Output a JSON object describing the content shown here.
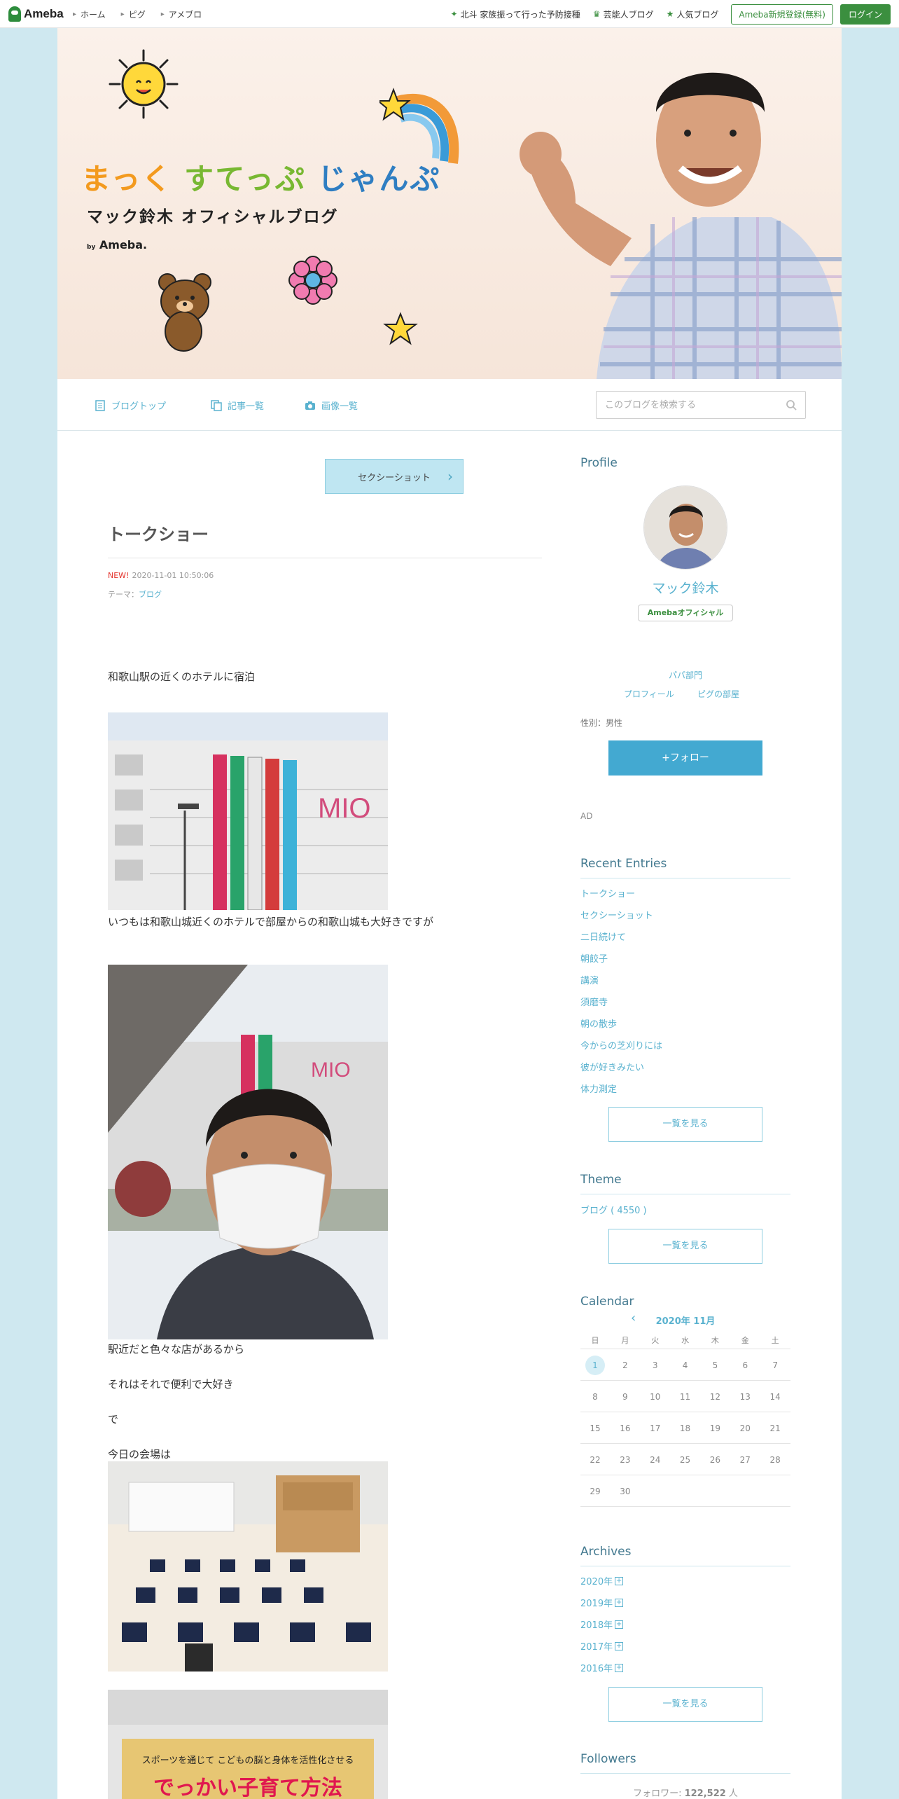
{
  "topbar": {
    "logo": "Ameba",
    "nav": [
      "ホーム",
      "ピグ",
      "アメブロ"
    ],
    "promos": [
      "北斗 家族振って行った予防接種",
      "芸能人ブログ",
      "人気ブログ"
    ],
    "register": "Ameba新規登録(無料)",
    "login": "ログイン"
  },
  "banner": {
    "title_a": "まっく",
    "title_b": "すてっぷ",
    "title_c": "じゃんぷ",
    "subtitle": "マック鈴木 オフィシャルブログ",
    "by": "by",
    "ameba": "Ameba."
  },
  "blognav": {
    "tabs": [
      "ブログトップ",
      "記事一覧",
      "画像一覧"
    ],
    "search_placeholder": "このブログを検索する"
  },
  "article": {
    "prev_label": "セクシーショット",
    "title": "トークショー",
    "new": "NEW!",
    "datetime": "2020-11-01 10:50:06",
    "theme_prefix": "テーマ：",
    "theme": "ブログ",
    "paragraphs": [
      "和歌山駅の近くのホテルに宿泊",
      "いつもは和歌山城近くのホテルで部屋からの和歌山城も大好きですが",
      "駅近だと色々な店があるから",
      "それはそれで便利で大好き",
      "で",
      "今日の会場は"
    ],
    "banner_text_top": "スポーツを通じて こどもの脳と身体を活性化させる",
    "banner_text_main": "でっかい子育て方法"
  },
  "sidebar": {
    "profile_title": "Profile",
    "name": "マック鈴木",
    "official": "Amebaオフィシャル",
    "category": "パパ部門",
    "profile_link": "プロフィール",
    "pig_link": "ピグの部屋",
    "gender": "性別：男性",
    "follow": "+フォロー",
    "ad": "AD",
    "recent_title": "Recent Entries",
    "recent": [
      "トークショー",
      "セクシーショット",
      "二日続けて",
      "朝餃子",
      "講演",
      "須磨寺",
      "朝の散歩",
      "今からの芝刈りには",
      "彼が好きみたい",
      "体力測定"
    ],
    "more": "一覧を見る",
    "theme_title": "Theme",
    "theme_item": "ブログ ( 4550 )",
    "calendar_title": "Calendar",
    "calendar_month": "2020年 11月",
    "weekdays": [
      "日",
      "月",
      "火",
      "水",
      "木",
      "金",
      "土"
    ],
    "days": [
      "1",
      "2",
      "3",
      "4",
      "5",
      "6",
      "7",
      "8",
      "9",
      "10",
      "11",
      "12",
      "13",
      "14",
      "15",
      "16",
      "17",
      "18",
      "19",
      "20",
      "21",
      "22",
      "23",
      "24",
      "25",
      "26",
      "27",
      "28",
      "29",
      "30"
    ],
    "archives_title": "Archives",
    "archives": [
      "2020年",
      "2019年",
      "2018年",
      "2017年",
      "2016年"
    ],
    "followers_title": "Followers",
    "followers_label": "フォロワー: ",
    "followers_count": "122,522",
    "followers_unit": " 人"
  },
  "colors": {
    "accent": "#5ab2cf",
    "brand_green": "#3b8f3f",
    "follow_blue": "#43a9d1",
    "page_bg": "#cfe8f0"
  }
}
